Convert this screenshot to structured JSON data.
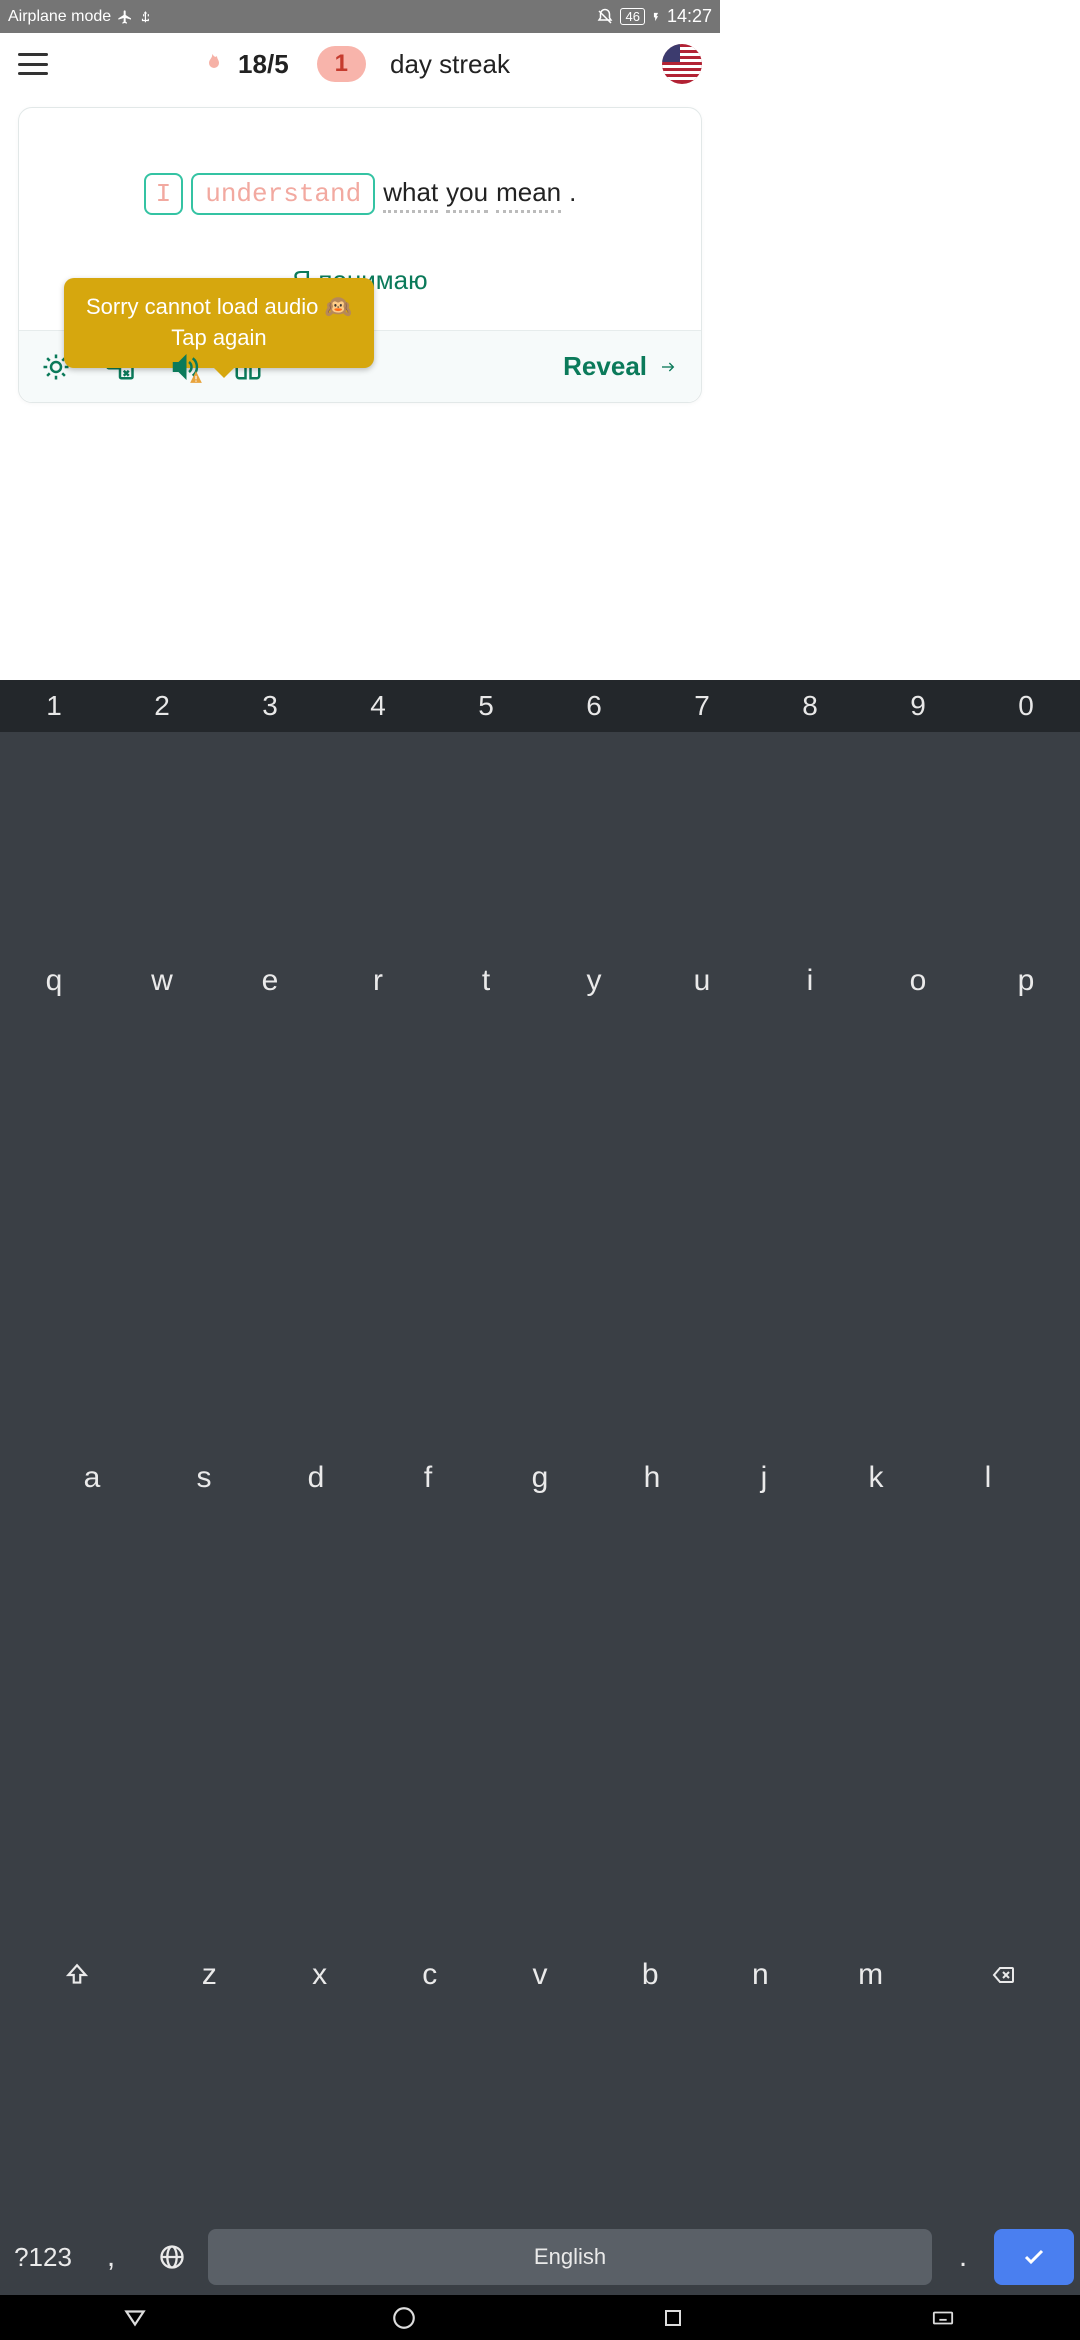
{
  "status": {
    "airplane_label": "Airplane mode",
    "battery": "46",
    "time": "14:27"
  },
  "header": {
    "counter": "18/5",
    "streak_count": "1",
    "streak_label": "day streak"
  },
  "card": {
    "blank1": "I",
    "blank2": "understand",
    "word3": "what",
    "word4": "you",
    "word5": "mean",
    "punct": ".",
    "translation": "Я понимаю",
    "tooltip_line1": "Sorry cannot load audio 🙉",
    "tooltip_line2": "Tap again",
    "reveal_label": "Reveal"
  },
  "keyboard": {
    "numbers": [
      "1",
      "2",
      "3",
      "4",
      "5",
      "6",
      "7",
      "8",
      "9",
      "0"
    ],
    "row1": [
      "q",
      "w",
      "e",
      "r",
      "t",
      "y",
      "u",
      "i",
      "o",
      "p"
    ],
    "row2": [
      "a",
      "s",
      "d",
      "f",
      "g",
      "h",
      "j",
      "k",
      "l"
    ],
    "row3": [
      "z",
      "x",
      "c",
      "v",
      "b",
      "n",
      "m"
    ],
    "sym": "?123",
    "comma": ",",
    "space_label": "English",
    "period": "."
  }
}
